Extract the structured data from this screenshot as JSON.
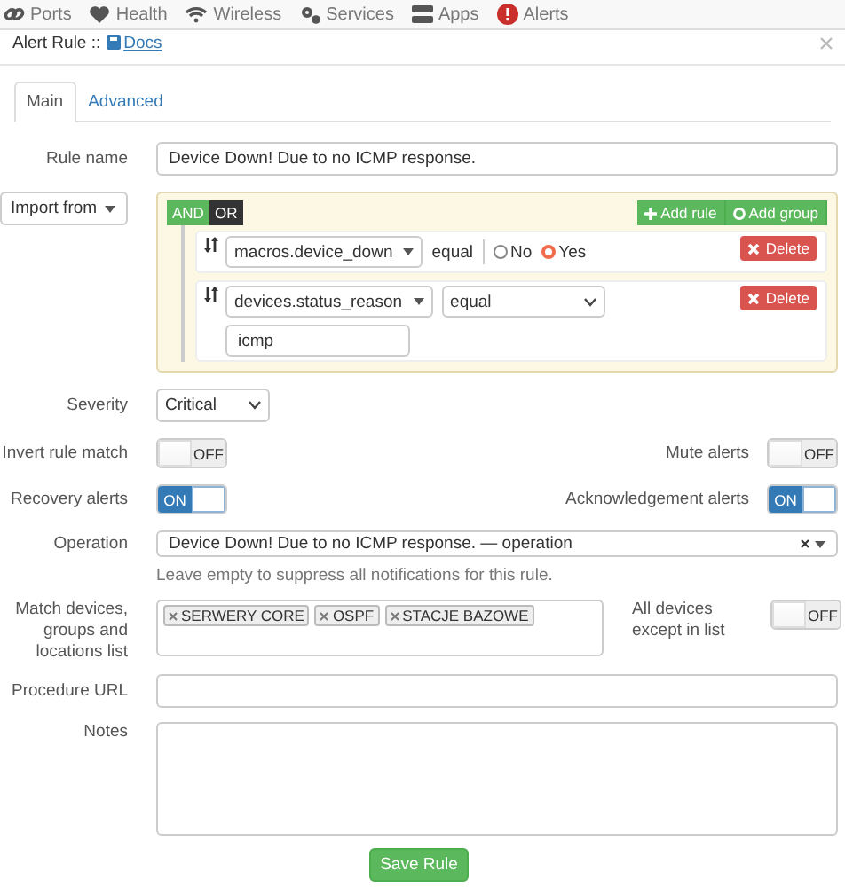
{
  "nav": [
    {
      "label": "Ports"
    },
    {
      "label": "Health"
    },
    {
      "label": "Wireless"
    },
    {
      "label": "Services"
    },
    {
      "label": "Apps"
    },
    {
      "label": "Alerts"
    }
  ],
  "modal": {
    "title": "Alert Rule ::",
    "docs_link": "Docs"
  },
  "tabs": [
    {
      "label": "Main",
      "selected": true
    },
    {
      "label": "Advanced",
      "selected": false
    }
  ],
  "rule_name": {
    "label": "Rule name",
    "value": "Device Down! Due to no ICMP response."
  },
  "import_button": "Import from",
  "builder": {
    "conditions": [
      {
        "label": "AND",
        "selected": true
      },
      {
        "label": "OR",
        "selected": false
      }
    ],
    "add_rule": "Add rule",
    "add_group": "Add group",
    "rules": [
      {
        "kind": "radio",
        "field": "macros.device_down",
        "operator": "equal",
        "options": [
          {
            "label": "No",
            "selected": false
          },
          {
            "label": "Yes",
            "selected": true
          }
        ],
        "delete": "Delete"
      },
      {
        "kind": "text",
        "field": "devices.status_reason",
        "operator": "equal",
        "value": "icmp",
        "delete": "Delete"
      }
    ]
  },
  "severity": {
    "label": "Severity",
    "value": "Critical"
  },
  "toggles": [
    {
      "label": "Invert rule match",
      "on": false,
      "text": "OFF"
    },
    {
      "label": "Mute alerts",
      "on": false,
      "text": "OFF"
    },
    {
      "label": "Recovery alerts",
      "on": true,
      "text": "ON"
    },
    {
      "label": "Acknowledgement alerts",
      "on": true,
      "text": "ON"
    }
  ],
  "operation": {
    "label": "Operation",
    "value": "Device Down! Due to no ICMP response. — operation",
    "help": "Leave empty to suppress all notifications for this rule."
  },
  "match": {
    "label": "Match devices, groups and locations list",
    "tags": [
      "SERWERY CORE",
      "OSPF",
      "STACJE BAZOWE"
    ],
    "except": {
      "label": "All devices except in list",
      "on": false,
      "text": "OFF"
    }
  },
  "procedure_url": {
    "label": "Procedure URL"
  },
  "notes": {
    "label": "Notes"
  },
  "save_button": "Save Rule"
}
